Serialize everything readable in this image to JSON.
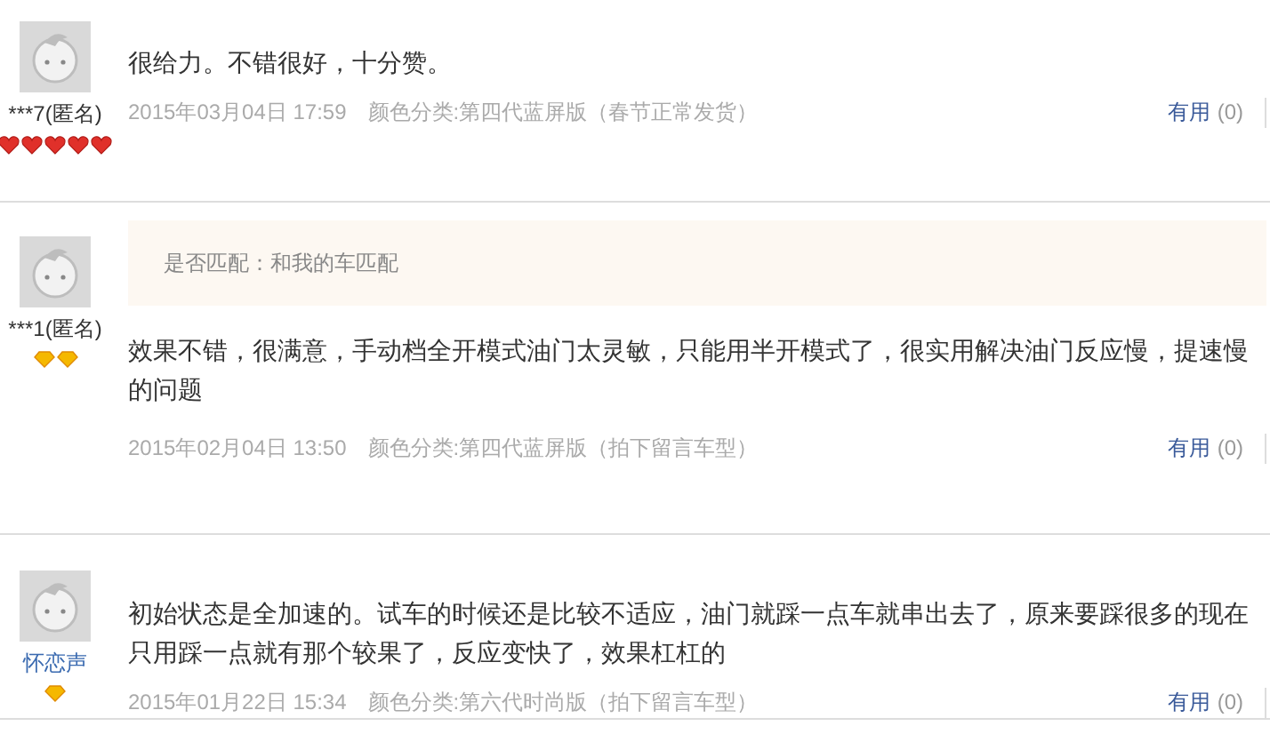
{
  "reviews": [
    {
      "user": {
        "name": "***7(匿名)",
        "link": false,
        "badges": [
          {
            "kind": "heart"
          },
          {
            "kind": "heart"
          },
          {
            "kind": "heart"
          },
          {
            "kind": "heart"
          },
          {
            "kind": "heart"
          }
        ]
      },
      "text": "很给力。不错很好，十分赞。",
      "date": "2015年03月04日 17:59",
      "variant": "颜色分类:第四代蓝屏版（春节正常发货）",
      "useful": {
        "label": "有用",
        "count": "(0)"
      }
    },
    {
      "user": {
        "name": "***1(匿名)",
        "link": false,
        "badges": [
          {
            "kind": "diamond"
          },
          {
            "kind": "diamond"
          }
        ]
      },
      "match": "是否匹配：和我的车匹配",
      "text": "效果不错，很满意，手动档全开模式油门太灵敏，只能用半开模式了，很实用解决油门反应慢，提速慢的问题",
      "date": "2015年02月04日 13:50",
      "variant": "颜色分类:第四代蓝屏版（拍下留言车型）",
      "useful": {
        "label": "有用",
        "count": "(0)"
      }
    },
    {
      "user": {
        "name": "怀恋声",
        "link": true,
        "badges": [
          {
            "kind": "diamond"
          }
        ]
      },
      "text": "初始状态是全加速的。试车的时候还是比较不适应，油门就踩一点车就串出去了，原来要踩很多的现在只用踩一点就有那个较果了，反应变快了，效果杠杠的",
      "date": "2015年01月22日 15:34",
      "variant": "颜色分类:第六代时尚版（拍下留言车型）",
      "useful": {
        "label": "有用",
        "count": "(0)"
      }
    }
  ]
}
